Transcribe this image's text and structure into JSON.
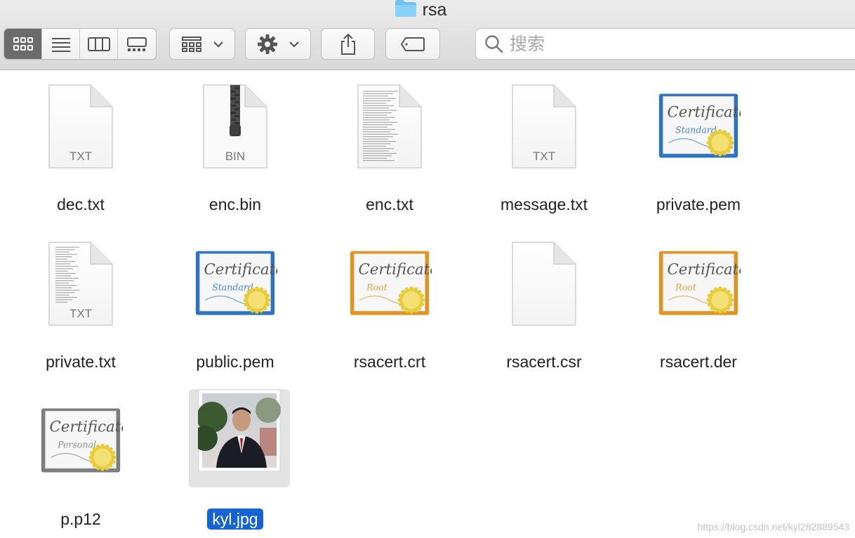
{
  "window": {
    "title": "rsa"
  },
  "toolbar": {
    "view_modes": [
      "icon-view",
      "list-view",
      "column-view",
      "gallery-view"
    ],
    "active_view": "icon-view",
    "search_placeholder": "搜索"
  },
  "files": [
    {
      "name": "dec.txt",
      "kind": "doc",
      "badge": "TXT"
    },
    {
      "name": "enc.bin",
      "kind": "zip",
      "badge": "BIN"
    },
    {
      "name": "enc.txt",
      "kind": "text-preview",
      "badge": ""
    },
    {
      "name": "message.txt",
      "kind": "doc",
      "badge": "TXT"
    },
    {
      "name": "private.pem",
      "kind": "cert",
      "ribbon": "Standard",
      "color": "#2c73c4"
    },
    {
      "name": "private.txt",
      "kind": "doc-lines",
      "badge": "TXT"
    },
    {
      "name": "public.pem",
      "kind": "cert",
      "ribbon": "Standard",
      "color": "#2c73c4"
    },
    {
      "name": "rsacert.crt",
      "kind": "cert",
      "ribbon": "Root",
      "color": "#e0951e"
    },
    {
      "name": "rsacert.csr",
      "kind": "blank",
      "badge": ""
    },
    {
      "name": "rsacert.der",
      "kind": "cert",
      "ribbon": "Root",
      "color": "#e0951e"
    },
    {
      "name": "p.p12",
      "kind": "cert",
      "ribbon": "Personal",
      "color": "#7d7d7d"
    },
    {
      "name": "kyl.jpg",
      "kind": "photo",
      "selected": true
    }
  ],
  "watermark": "https://blog.csdn.net/kyl282889543"
}
